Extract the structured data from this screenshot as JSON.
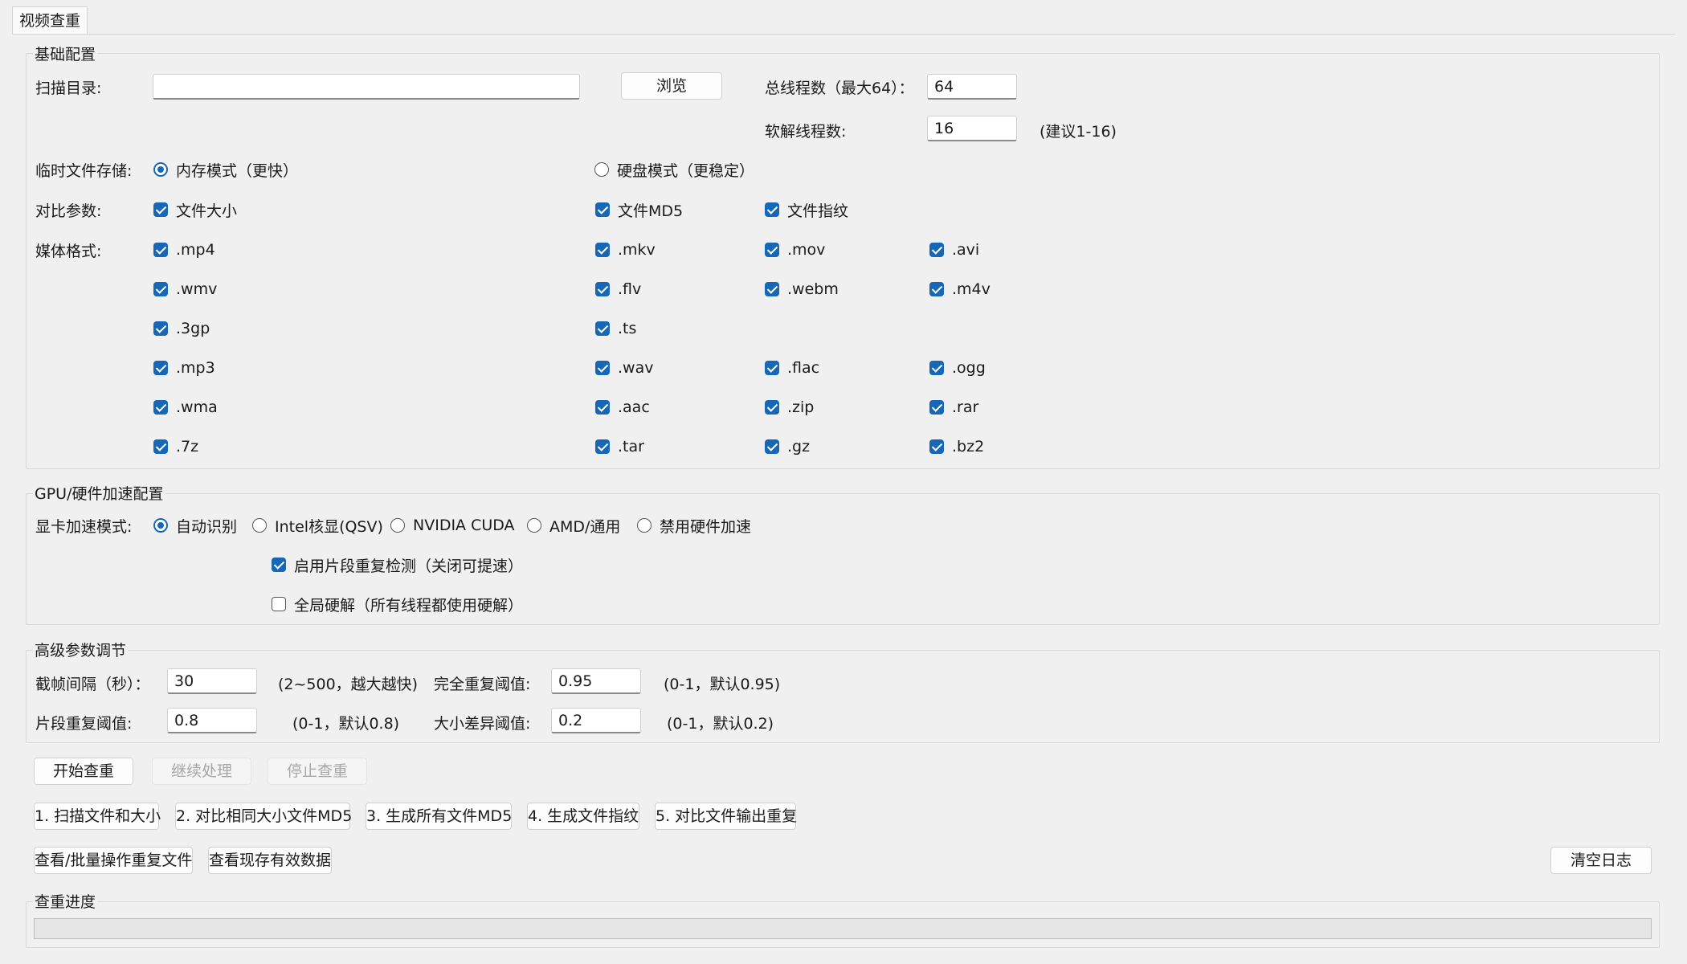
{
  "tab": {
    "label": "视频查重"
  },
  "basic": {
    "title": "基础配置",
    "scan_dir_label": "扫描目录:",
    "scan_dir_value": "",
    "browse_label": "浏览",
    "total_threads_label": "总线程数（最大64）：",
    "total_threads_value": "64",
    "soft_threads_label": "软解线程数:",
    "soft_threads_value": "16",
    "soft_threads_hint": "(建议1-16)",
    "temp_storage_label": "临时文件存储:",
    "temp_memory_label": "内存模式（更快）",
    "temp_disk_label": "硬盘模式（更稳定）",
    "temp_selected": "memory",
    "compare_label": "对比参数:",
    "compare_options": [
      {
        "label": "文件大小",
        "checked": true
      },
      {
        "label": "文件MD5",
        "checked": true
      },
      {
        "label": "文件指纹",
        "checked": true
      }
    ],
    "media_label": "媒体格式:",
    "media_rows": [
      [
        ".mp4",
        ".mkv",
        ".mov",
        ".avi"
      ],
      [
        ".wmv",
        ".flv",
        ".webm",
        ".m4v"
      ],
      [
        ".3gp",
        ".ts"
      ],
      [
        ".mp3",
        ".wav",
        ".flac",
        ".ogg"
      ],
      [
        ".wma",
        ".aac",
        ".zip",
        ".rar"
      ],
      [
        ".7z",
        ".tar",
        ".gz",
        ".bz2"
      ]
    ]
  },
  "gpu": {
    "title": "GPU/硬件加速配置",
    "mode_label": "显卡加速模式:",
    "modes": [
      "自动识别",
      "Intel核显(QSV)",
      "NVIDIA CUDA",
      "AMD/通用",
      "禁用硬件加速"
    ],
    "selected_mode": 0,
    "segment_check_label": "启用片段重复检测（关闭可提速）",
    "segment_check": true,
    "global_hw_label": "全局硬解（所有线程都使用硬解）",
    "global_hw": false
  },
  "advanced": {
    "title": "高级参数调节",
    "frame_interval_label": "截帧间隔（秒）：",
    "frame_interval_value": "30",
    "frame_interval_hint": "(2~500，越大越快)",
    "full_dup_label": "完全重复阈值:",
    "full_dup_value": "0.95",
    "full_dup_hint": "(0-1，默认0.95)",
    "segment_dup_label": "片段重复阈值:",
    "segment_dup_value": "0.8",
    "segment_dup_hint": "(0-1，默认0.8)",
    "size_diff_label": "大小差异阈值:",
    "size_diff_value": "0.2",
    "size_diff_hint": "(0-1，默认0.2)"
  },
  "actions": {
    "start": "开始查重",
    "resume": "继续处理",
    "stop": "停止查重",
    "steps": [
      "1. 扫描文件和大小",
      "2. 对比相同大小文件MD5",
      "3. 生成所有文件MD5",
      "4. 生成文件指纹",
      "5. 对比文件输出重复"
    ],
    "view_dups": "查看/批量操作重复文件",
    "view_data": "查看现存有效数据",
    "clear_log": "清空日志"
  },
  "progress": {
    "title": "查重进度",
    "value": 0
  },
  "colors": {
    "accent": "#1667b5",
    "background": "#f0f0f0"
  }
}
